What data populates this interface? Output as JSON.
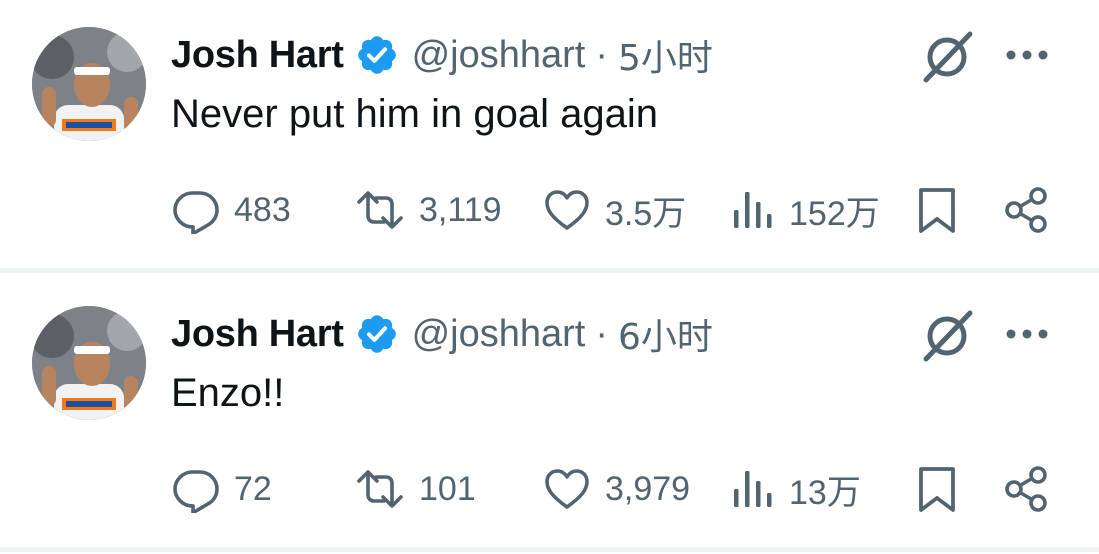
{
  "colors": {
    "text": "#0f1419",
    "secondary": "#536471",
    "verified": "#1d9bf0",
    "divider": "#eff3f4"
  },
  "icons": {
    "reply": "reply-icon",
    "retweet": "retweet-icon",
    "like": "heart-icon",
    "views": "views-icon",
    "bookmark": "bookmark-icon",
    "share": "share-icon",
    "grok": "grok-icon",
    "more": "more-icon",
    "verified": "verified-badge-icon"
  },
  "tweets": [
    {
      "name": "Josh Hart",
      "handle": "@joshhart",
      "separator": "·",
      "time": "5小时",
      "text": "Never put him in goal again",
      "replies": "483",
      "retweets": "3,119",
      "likes": "3.5万",
      "views": "152万"
    },
    {
      "name": "Josh Hart",
      "handle": "@joshhart",
      "separator": "·",
      "time": "6小时",
      "text": "Enzo!!",
      "replies": "72",
      "retweets": "101",
      "likes": "3,979",
      "views": "13万"
    }
  ]
}
